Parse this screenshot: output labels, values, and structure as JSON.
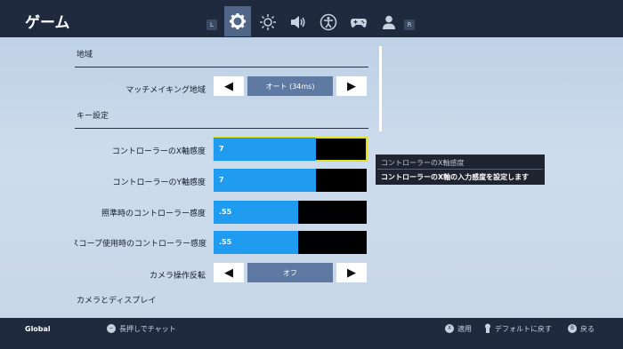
{
  "header": {
    "title": "ゲーム",
    "left_badge": "L",
    "right_badge": "R",
    "tabs": [
      {
        "icon": "gear-icon",
        "active": true
      },
      {
        "icon": "brightness-icon",
        "active": false
      },
      {
        "icon": "speaker-icon",
        "active": false
      },
      {
        "icon": "accessibility-icon",
        "active": false
      },
      {
        "icon": "gamepad-icon",
        "active": false
      },
      {
        "icon": "account-icon",
        "active": false
      }
    ]
  },
  "sections": {
    "region": "地域",
    "keys": "キー設定",
    "camera": "カメラとディスプレイ"
  },
  "matchmaking": {
    "label": "マッチメイキング地域",
    "value": "オート (34ms)"
  },
  "sliders": [
    {
      "label": "コントローラーのX軸感度",
      "value": "7",
      "fill": 0.67
    },
    {
      "label": "コントローラーのY軸感度",
      "value": "7",
      "fill": 0.67
    },
    {
      "label": "照準時のコントローラー感度",
      "value": ".55",
      "fill": 0.55
    },
    {
      "label": "スコープ使用時のコントローラー感度",
      "value": ".55",
      "fill": 0.55
    }
  ],
  "camera_invert": {
    "label": "カメラ操作反転",
    "value": "オフ"
  },
  "tooltip": {
    "title": "コントローラーのX軸感度",
    "description": "コントローラーのX軸の入力感度を設定します"
  },
  "footer": {
    "scope": "Global",
    "chat_hint": "長押しでチャット",
    "apply": "適用",
    "reset": "デフォルトに戻す",
    "back": "戻る",
    "apply_btn": "X",
    "back_btn": "B"
  },
  "colors": {
    "header_bg": "#1f2a3f",
    "slider_fill": "#1f9cf0",
    "select_bg": "#5e79a2",
    "focus_outline": "#e0e21e"
  }
}
